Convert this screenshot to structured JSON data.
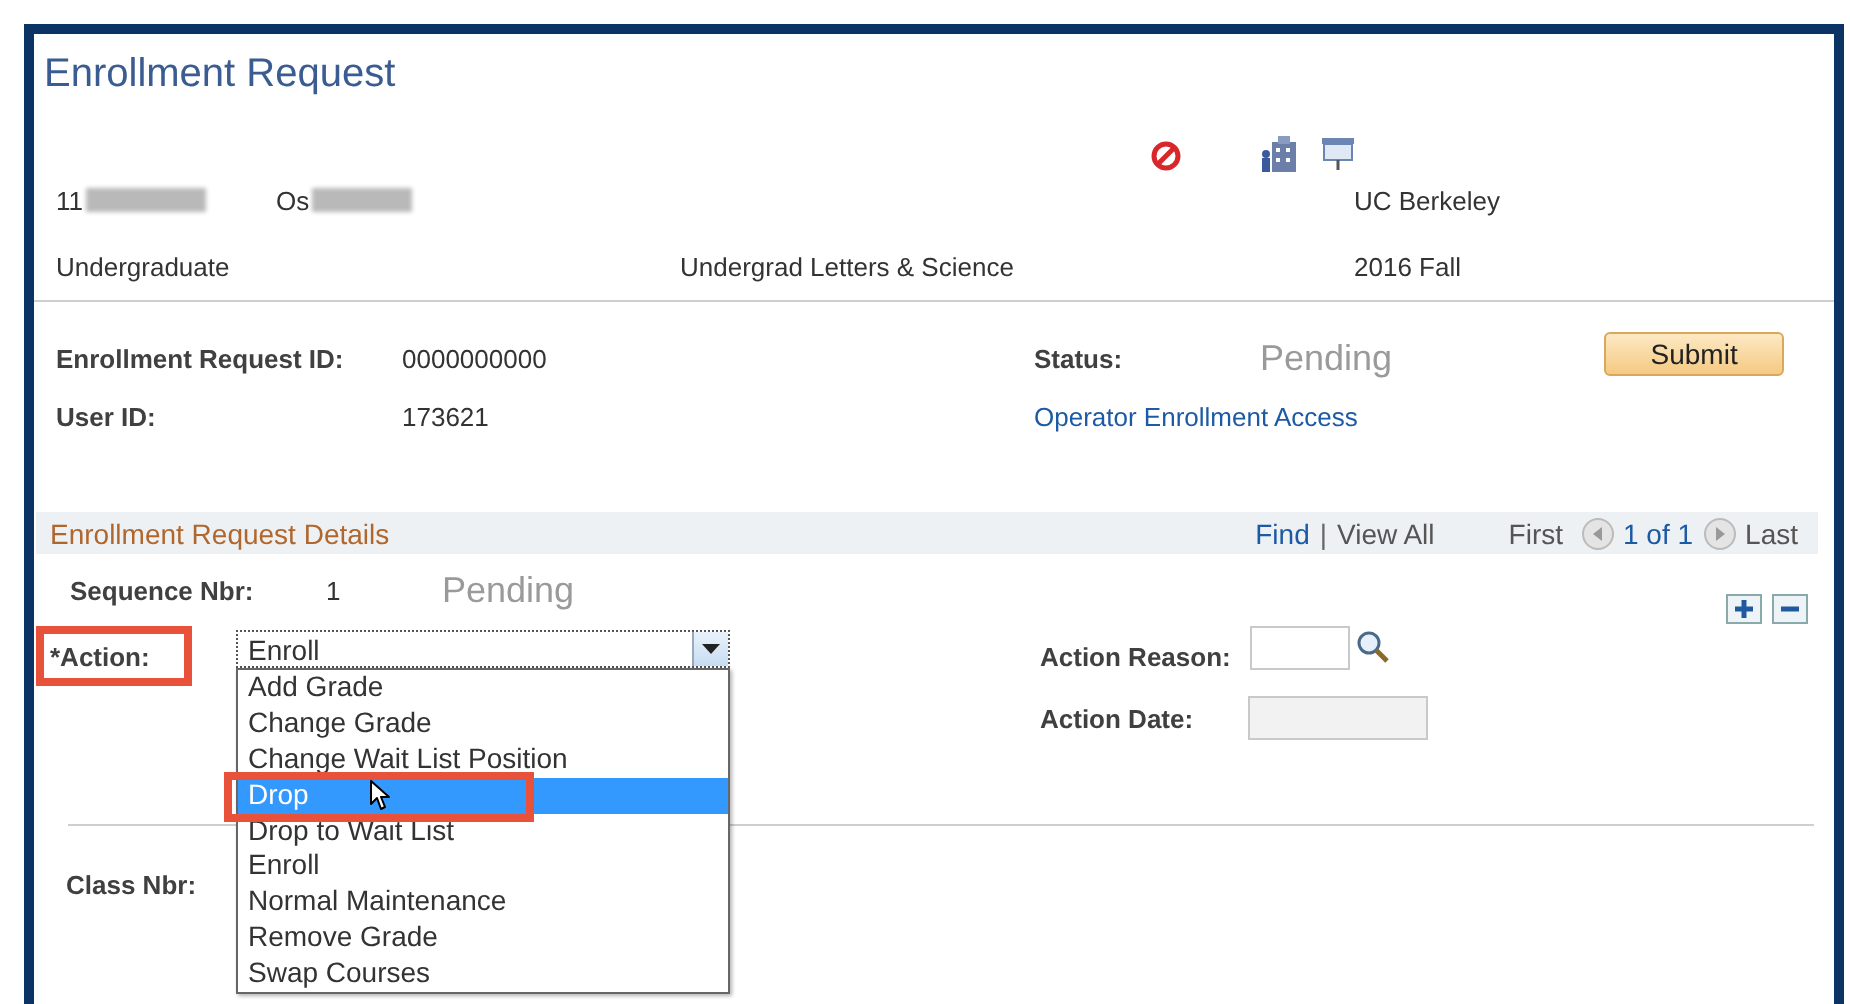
{
  "title": "Enrollment Request",
  "student": {
    "id_prefix": "11",
    "name_prefix": "Os",
    "institution": "UC Berkeley",
    "career": "Undergraduate",
    "program": "Undergrad Letters & Science",
    "term": "2016 Fall"
  },
  "request": {
    "fields": [
      {
        "label": "Enrollment Request ID:",
        "value": "0000000000"
      },
      {
        "label": "User ID:",
        "value": "173621"
      }
    ],
    "status_label": "Status:",
    "status": "Pending",
    "link": "Operator Enrollment Access",
    "submit": "Submit"
  },
  "details": {
    "title": "Enrollment Request Details",
    "find": "Find",
    "separator": "|",
    "view_all": "View All",
    "first": "First",
    "count": "1 of 1",
    "last": "Last",
    "sequence_label": "Sequence Nbr:",
    "sequence": "1",
    "sequence_status": "Pending",
    "action_label": "*Action:",
    "action_value": "Enroll",
    "action_options": [
      {
        "label": "Add Grade",
        "selected": false
      },
      {
        "label": "Change Grade",
        "selected": false
      },
      {
        "label": "Change Wait List Position",
        "selected": false
      },
      {
        "label": "Drop",
        "selected": true
      },
      {
        "label": "Drop to Wait List",
        "selected": false
      },
      {
        "label": "Enroll",
        "selected": false
      },
      {
        "label": "Normal Maintenance",
        "selected": false
      },
      {
        "label": "Remove Grade",
        "selected": false
      },
      {
        "label": "Swap Courses",
        "selected": false
      }
    ],
    "reason_label": "Action Reason:",
    "date_label": "Action Date:",
    "class_label": "Class Nbr:"
  }
}
